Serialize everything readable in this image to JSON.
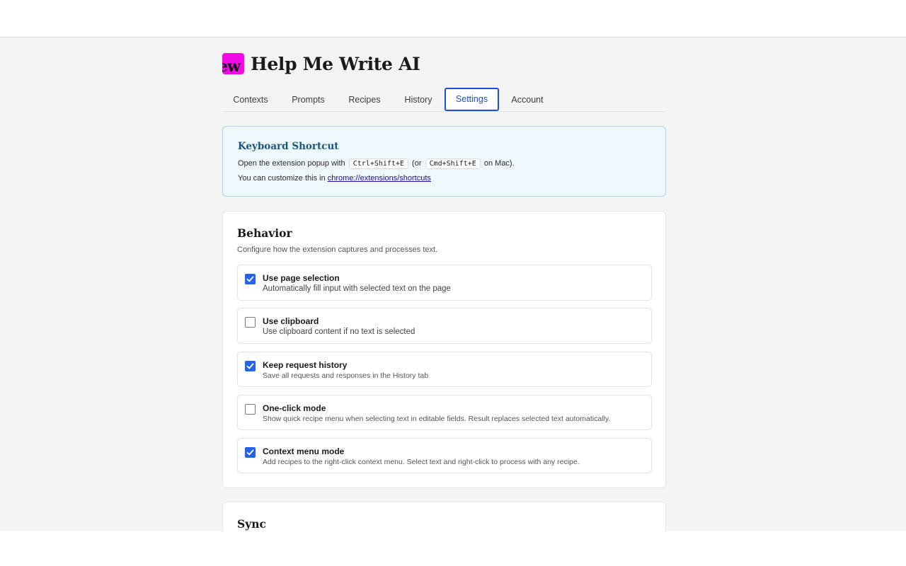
{
  "app": {
    "logo_text": "ew",
    "title": "Help Me Write AI"
  },
  "tabs": [
    {
      "label": "Contexts",
      "active": false
    },
    {
      "label": "Prompts",
      "active": false
    },
    {
      "label": "Recipes",
      "active": false
    },
    {
      "label": "History",
      "active": false
    },
    {
      "label": "Settings",
      "active": true
    },
    {
      "label": "Account",
      "active": false
    }
  ],
  "shortcut": {
    "title": "Keyboard Shortcut",
    "line1_prefix": "Open the extension popup with",
    "kbd_win": "Ctrl+Shift+E",
    "line1_mid": "(or",
    "kbd_mac": "Cmd+Shift+E",
    "line1_suffix": "on Mac).",
    "line2_prefix": "You can customize this in",
    "line2_link": "chrome://extensions/shortcuts"
  },
  "behavior": {
    "title": "Behavior",
    "description": "Configure how the extension captures and processes text.",
    "options": [
      {
        "label": "Use page selection",
        "description": "Automatically fill input with selected text on the page",
        "checked": true
      },
      {
        "label": "Use clipboard",
        "description": "Use clipboard content if no text is selected",
        "checked": false
      },
      {
        "label": "Keep request history",
        "description": "Save all requests and responses in the History tab",
        "checked": true
      },
      {
        "label": "One-click mode",
        "description": "Show quick recipe menu when selecting text in editable fields. Result replaces selected text automatically.",
        "checked": false
      },
      {
        "label": "Context menu mode",
        "description": "Add recipes to the right-click context menu. Select text and right-click to process with any recipe.",
        "checked": true
      }
    ]
  },
  "sync": {
    "title": "Sync"
  },
  "colors": {
    "accent": "#2563eb",
    "logo_bg": "#f20ae5",
    "info_bg": "#eef7fc",
    "info_title": "#19577a"
  }
}
